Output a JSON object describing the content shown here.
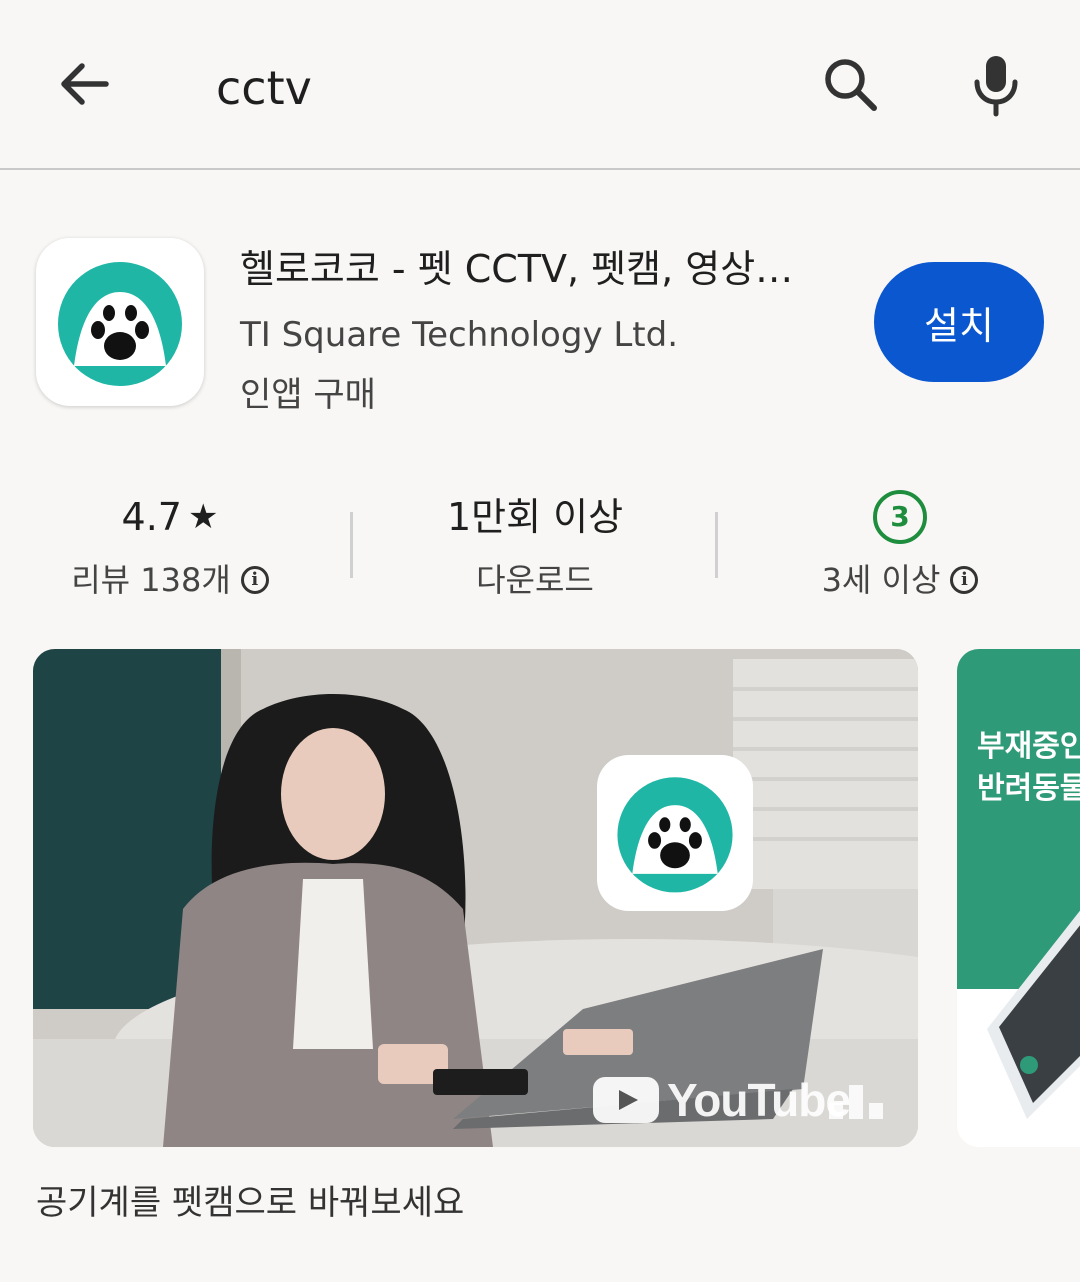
{
  "search": {
    "query": "cctv"
  },
  "app": {
    "title": "헬로코코 - 펫 CCTV, 펫캠, 영상…",
    "developer": "TI Square Technology Ltd.",
    "in_app": "인앱 구매",
    "install_label": "설치"
  },
  "stats": {
    "rating": "4.7",
    "rating_star": "★",
    "reviews": "리뷰 138개",
    "downloads": "1만회 이상",
    "downloads_label": "다운로드",
    "age_badge": "3",
    "age_label": "3세 이상",
    "info_glyph": "i"
  },
  "media": {
    "youtube_label": "YouTube",
    "screenshot2_line1": "부재중인",
    "screenshot2_line2": "반려동물"
  },
  "caption": "공기계를 펫캠으로 바꿔보세요",
  "colors": {
    "accent": "#0b57d0",
    "brand_teal": "#1fb6a6",
    "age_green": "#1e8e3e",
    "screenshot_green": "#2f9a77"
  },
  "icons": [
    "arrow-back-icon",
    "search-icon",
    "mic-icon",
    "paw-icon",
    "star-icon",
    "info-icon",
    "youtube-play-icon",
    "youtube-bars-icon"
  ]
}
